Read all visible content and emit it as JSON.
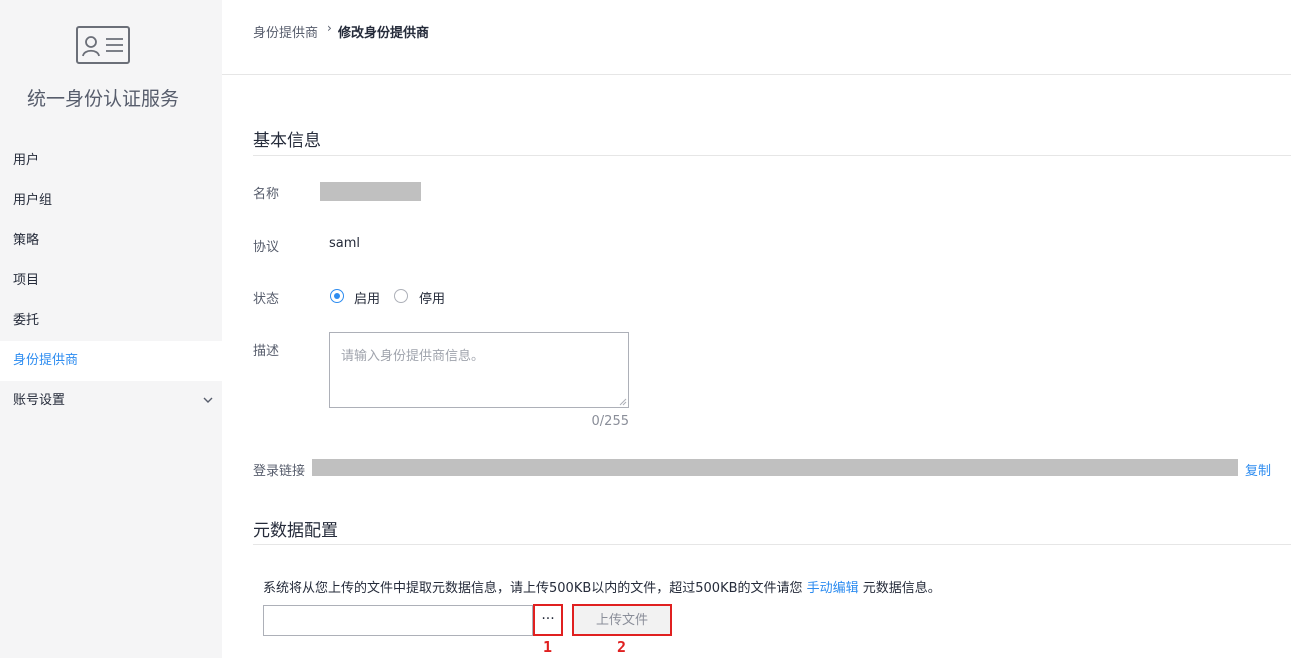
{
  "sidebar": {
    "logo_icon": "id-card-icon",
    "title": "统一身份认证服务",
    "items": [
      {
        "label": "用户"
      },
      {
        "label": "用户组"
      },
      {
        "label": "策略"
      },
      {
        "label": "项目"
      },
      {
        "label": "委托"
      },
      {
        "label": "身份提供商",
        "active": true
      },
      {
        "label": "账号设置",
        "expand_icon": "chevron-down-icon"
      }
    ]
  },
  "breadcrumb": {
    "parent": "身份提供商",
    "separator": "›",
    "current": "修改身份提供商"
  },
  "basic_info": {
    "title": "基本信息",
    "name_label": "名称",
    "protocol_label": "协议",
    "protocol_value": "saml",
    "status_label": "状态",
    "status_options": [
      {
        "label": "启用",
        "selected": true
      },
      {
        "label": "停用",
        "selected": false
      }
    ],
    "desc_label": "描述",
    "desc_placeholder": "请输入身份提供商信息。",
    "desc_count": "0/255",
    "login_link_label": "登录链接",
    "copy_label": "复制"
  },
  "metadata": {
    "title": "元数据配置",
    "desc_prefix": "系统将从您上传的文件中提取元数据信息，请上传500KB以内的文件，超过500KB的文件请您 ",
    "desc_link": "手动编辑",
    "desc_suffix": " 元数据信息。",
    "browse_label": "···",
    "upload_label": "上传文件",
    "callout_1": "1",
    "callout_2": "2"
  },
  "colors": {
    "accent": "#2d8cf0",
    "callout": "#e02020",
    "sidebar_bg": "#f5f5f6",
    "mask": "#c0c0c0"
  }
}
